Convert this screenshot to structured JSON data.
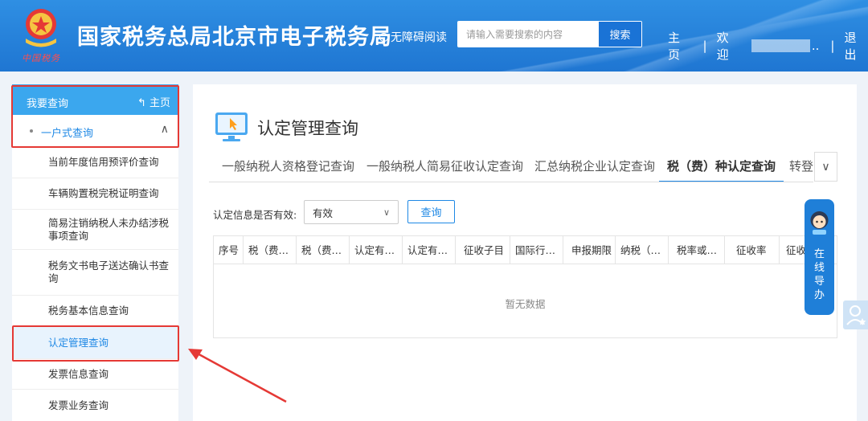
{
  "header": {
    "emblem_subtitle": "中国税务",
    "site_title": "国家税务总局北京市电子税务局",
    "accessibility_label": "无障碍阅读",
    "search": {
      "placeholder": "请输入需要搜索的内容",
      "button_label": "搜索"
    },
    "links": {
      "home": "主页",
      "welcome": "欢迎",
      "dots": "..",
      "logout": "退出"
    }
  },
  "sidebar": {
    "header_title": "我要查询",
    "header_home": "主页",
    "group_label": "一户式查询",
    "items": [
      {
        "label": "当前年度信用预评价查询"
      },
      {
        "label": "车辆购置税完税证明查询"
      },
      {
        "label": "简易注销纳税人未办结涉税事项查询"
      },
      {
        "label": "税务文书电子送达确认书查询"
      },
      {
        "label": "税务基本信息查询"
      },
      {
        "label": "认定管理查询"
      },
      {
        "label": "发票信息查询"
      },
      {
        "label": "发票业务查询"
      }
    ],
    "active_item": "认定管理查询"
  },
  "main": {
    "page_title": "认定管理查询",
    "tabs": [
      {
        "label": "一般纳税人资格登记查询"
      },
      {
        "label": "一般纳税人简易征收认定查询"
      },
      {
        "label": "汇总纳税企业认定查询"
      },
      {
        "label": "税（费）种认定查询"
      },
      {
        "label": "转登记"
      }
    ],
    "active_tab": "税（费）种认定查询",
    "filter": {
      "label": "认定信息是否有效:",
      "selected": "有效",
      "query_button": "查询"
    },
    "table": {
      "columns": [
        "序号",
        "税（费…",
        "税（费…",
        "认定有…",
        "认定有…",
        "征收子目",
        "国际行…",
        "申报期限",
        "纳税（…",
        "税率或…",
        "征收率",
        "征收"
      ],
      "empty_text": "暂无数据"
    }
  },
  "guide": {
    "label": "在线导办"
  },
  "colors": {
    "header_blue": "#2584dc",
    "accent": "#1e88e5",
    "annotation_red": "#e53935"
  }
}
